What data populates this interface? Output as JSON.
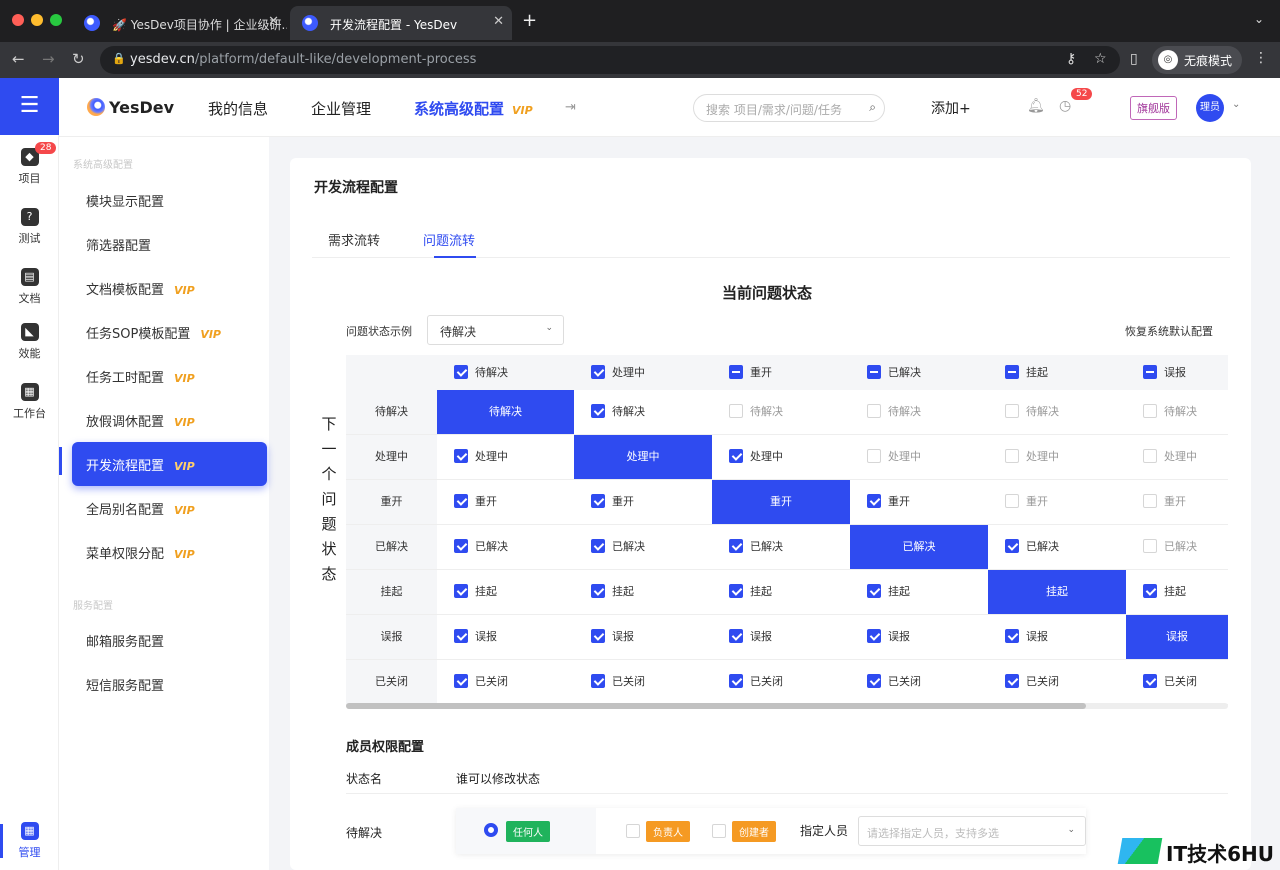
{
  "browser": {
    "tabs": [
      {
        "label": "🚀 YesDev项目协作 | 企业级研..."
      },
      {
        "label": "开发流程配置 - YesDev"
      }
    ],
    "url_domain": "yesdev.cn",
    "url_path": "/platform/default-like/development-process",
    "incognito_label": "无痕模式"
  },
  "rail": {
    "items": [
      {
        "label": "项目",
        "badge": "28",
        "icon": "cube-icon"
      },
      {
        "label": "测试",
        "icon": "bug-icon"
      },
      {
        "label": "文档",
        "icon": "doc-icon"
      },
      {
        "label": "效能",
        "icon": "chart-icon"
      },
      {
        "label": "工作台",
        "icon": "grid-icon"
      },
      {
        "label": "管理",
        "icon": "manage-icon"
      }
    ]
  },
  "header": {
    "logo": "YesDev",
    "nav": [
      {
        "label": "我的信息"
      },
      {
        "label": "企业管理"
      },
      {
        "label": "系统高级配置",
        "vip": "VIP"
      }
    ],
    "search_placeholder": "搜索 项目/需求/问题/任务",
    "add_label": "添加+",
    "clock_badge": "52",
    "edition": "旗舰版",
    "avatar": "理员"
  },
  "sidebar": {
    "group1": "系统高级配置",
    "group2": "服务配置",
    "items": [
      {
        "label": "模块显示配置",
        "vip": ""
      },
      {
        "label": "筛选器配置",
        "vip": ""
      },
      {
        "label": "文档模板配置",
        "vip": "VIP"
      },
      {
        "label": "任务SOP模板配置",
        "vip": "VIP"
      },
      {
        "label": "任务工时配置",
        "vip": "VIP"
      },
      {
        "label": "放假调休配置",
        "vip": "VIP"
      },
      {
        "label": "开发流程配置",
        "vip": "VIP"
      },
      {
        "label": "全局别名配置",
        "vip": "VIP"
      },
      {
        "label": "菜单权限分配",
        "vip": "VIP"
      }
    ],
    "service_items": [
      {
        "label": "邮箱服务配置"
      },
      {
        "label": "短信服务配置"
      }
    ]
  },
  "panel": {
    "title": "开发流程配置",
    "tabs": [
      {
        "label": "需求流转"
      },
      {
        "label": "问题流转"
      }
    ],
    "current_state_title": "当前问题状态",
    "example_label": "问题状态示例",
    "example_value": "待解决",
    "reset_label": "恢复系统默认配置",
    "vertical_title": "下一个问题状态",
    "columns": [
      {
        "label": "待解决",
        "state": "checked"
      },
      {
        "label": "处理中",
        "state": "checked"
      },
      {
        "label": "重开",
        "state": "indeterminate"
      },
      {
        "label": "已解决",
        "state": "indeterminate"
      },
      {
        "label": "挂起",
        "state": "indeterminate"
      },
      {
        "label": "误报",
        "state": "indeterminate"
      }
    ],
    "rows": [
      {
        "label": "待解决",
        "cells": [
          "diag",
          "on",
          "off",
          "off",
          "off",
          "off"
        ]
      },
      {
        "label": "处理中",
        "cells": [
          "on",
          "diag",
          "on",
          "off",
          "off",
          "off"
        ]
      },
      {
        "label": "重开",
        "cells": [
          "on",
          "on",
          "diag",
          "on",
          "off",
          "off"
        ]
      },
      {
        "label": "已解决",
        "cells": [
          "on",
          "on",
          "on",
          "diag",
          "on",
          "off"
        ]
      },
      {
        "label": "挂起",
        "cells": [
          "on",
          "on",
          "on",
          "on",
          "diag",
          "on"
        ]
      },
      {
        "label": "误报",
        "cells": [
          "on",
          "on",
          "on",
          "on",
          "on",
          "diag"
        ]
      },
      {
        "label": "已关闭",
        "cells": [
          "on",
          "on",
          "on",
          "on",
          "on",
          "on"
        ]
      }
    ],
    "members": {
      "title": "成员权限配置",
      "col_name": "状态名",
      "col_who": "谁可以修改状态",
      "row_name": "待解决",
      "anyone": "任何人",
      "owner": "负责人",
      "creator": "创建者",
      "designate": "指定人员",
      "person_placeholder": "请选择指定人员，支持多选"
    }
  },
  "watermark": "IT技术6HU",
  "colors": {
    "primary": "#2f4bf0",
    "vip": "#f0a020",
    "green": "#20b35c",
    "orange": "#f59a23"
  }
}
